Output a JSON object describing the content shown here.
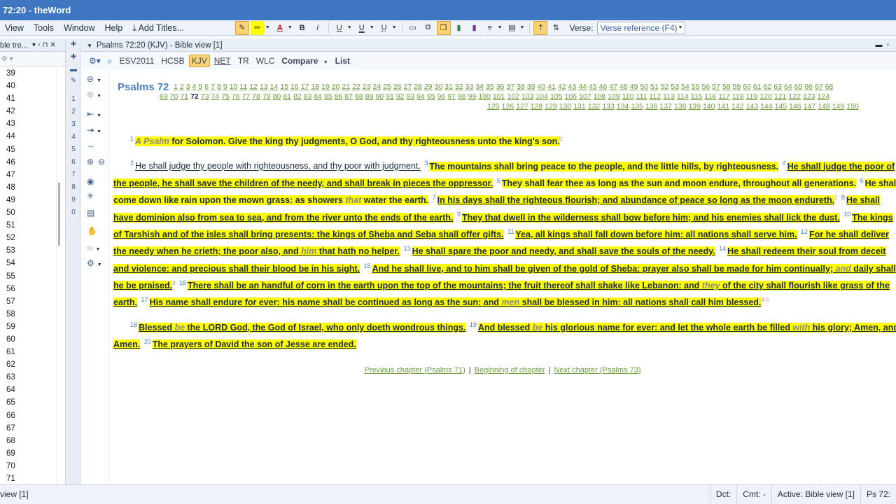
{
  "window": {
    "title": "72:20 - theWord"
  },
  "menu": [
    "View",
    "Tools",
    "Window",
    "Help",
    "Add Titles..."
  ],
  "toolbar": {
    "verse_label": "Verse:",
    "verse_select": "Verse reference (F4)"
  },
  "left_panel": {
    "tab_title": "ble tre...",
    "numbers": [
      "39",
      "40",
      "41",
      "42",
      "43",
      "44",
      "45",
      "46",
      "47",
      "48",
      "49",
      "50",
      "51",
      "52",
      "53",
      "54",
      "55",
      "56",
      "57",
      "58",
      "59",
      "60",
      "61",
      "62",
      "63",
      "64",
      "65",
      "66",
      "67",
      "68",
      "69",
      "70",
      "71"
    ]
  },
  "doc_tab": {
    "title": "Psalms 72:20 (KJV) - Bible view [1]"
  },
  "bible_toolbar": {
    "versions": [
      "ESV2011",
      "HCSB",
      "KJV",
      "NET",
      "TR",
      "WLC"
    ],
    "active_version": "KJV",
    "compare": "Compare",
    "list": "List"
  },
  "bookmarks": [
    "1",
    "2",
    "3",
    "4",
    "5",
    "6",
    "7",
    "8",
    "9",
    "0"
  ],
  "chapter": {
    "title": "Psalms 72",
    "rows": [
      [
        "1",
        "2",
        "3",
        "4",
        "5",
        "6",
        "7",
        "8",
        "9",
        "10",
        "11",
        "12",
        "13",
        "14",
        "15",
        "16",
        "17",
        "18",
        "19",
        "20",
        "21",
        "22",
        "23",
        "24",
        "25",
        "26",
        "27",
        "28",
        "29",
        "30",
        "31",
        "32",
        "33",
        "34",
        "35",
        "36",
        "37",
        "38",
        "39",
        "40",
        "41",
        "42",
        "43",
        "44",
        "45",
        "46",
        "47",
        "48",
        "49",
        "50",
        "51",
        "52",
        "53",
        "54",
        "55",
        "56",
        "57",
        "58",
        "59",
        "60",
        "61",
        "62",
        "63",
        "64",
        "65",
        "66",
        "67",
        "68"
      ],
      [
        "69",
        "70",
        "71",
        "72",
        "73",
        "74",
        "75",
        "76",
        "77",
        "78",
        "79",
        "80",
        "81",
        "82",
        "83",
        "84",
        "85",
        "86",
        "87",
        "88",
        "89",
        "90",
        "91",
        "92",
        "93",
        "94",
        "95",
        "96",
        "97",
        "98",
        "99",
        "100",
        "101",
        "102",
        "103",
        "104",
        "105",
        "106",
        "107",
        "108",
        "109",
        "110",
        "111",
        "112",
        "113",
        "114",
        "115",
        "116",
        "117",
        "118",
        "119",
        "120",
        "121",
        "122",
        "123",
        "124"
      ],
      [
        "125",
        "126",
        "127",
        "128",
        "129",
        "130",
        "131",
        "132",
        "133",
        "134",
        "135",
        "136",
        "137",
        "138",
        "139",
        "140",
        "141",
        "142",
        "143",
        "144",
        "145",
        "146",
        "147",
        "148",
        "149",
        "150"
      ]
    ],
    "current": "72"
  },
  "verses": {
    "v1_num": "1",
    "v1_it": "A Psalm",
    "v1_text": " for Solomon. Give the king thy judgments, O God, and thy righteousness unto the king's son.",
    "v1_fn": "1",
    "v2_num": "2",
    "v2_text": "He shall judge thy people with righteousness, and thy poor with judgment.",
    "v3_num": "3",
    "v3_text": "The mountains shall bring peace to the people, and the little hills, by righteousness.",
    "v4_num": "4",
    "v4_text": "He shall judge the poor of the people, he shall save the children of the needy, and shall break in pieces the oppressor.",
    "v5_num": "5",
    "v5_text": "They shall fear thee as long as the sun and moon endure, throughout all generations.",
    "v6_num": "6",
    "v6_a": "He shall come down like rain upon the mown grass: as showers ",
    "v6_it": "that",
    "v6_b": " water the earth.",
    "v7_num": "7",
    "v7_text": "In his days shall the righteous flourish; and abundance of peace so long as the moon endureth.",
    "v7_fn": "2",
    "v8_num": "8",
    "v8_text": "He shall have dominion also from sea to sea, and from the river unto the ends of the earth.",
    "v9_num": "9",
    "v9_text": "They that dwell in the wilderness shall bow before him; and his enemies shall lick the dust.",
    "v10_num": "10",
    "v10_text": "The kings of Tarshish and of the isles shall bring presents: the kings of Sheba and Seba shall offer gifts.",
    "v11_num": "11",
    "v11_text": "Yea, all kings shall fall down before him: all nations shall serve him.",
    "v12_num": "12",
    "v12_a": "For he shall deliver the needy when he crieth; the poor also, and ",
    "v12_it": "him",
    "v12_b": " that hath no helper.",
    "v13_num": "13",
    "v13_text": "He shall spare the poor and needy, and shall save the souls of the needy.",
    "v14_num": "14",
    "v14_text": "He shall redeem their soul from deceit and violence: and precious shall their blood be in his sight.",
    "v15_num": "15",
    "v15_a": "And he shall live, and to him shall be given of the gold of Sheba: prayer also shall be made for him continually; ",
    "v15_it": "and",
    "v15_b": " daily shall he be praised.",
    "v15_fn": "3",
    "v16_num": "16",
    "v16_a": "There shall be an handful of corn in the earth upon the top of the mountains; the fruit thereof shall shake like Lebanon: and ",
    "v16_it": "they",
    "v16_b": " of the city shall flourish like grass of the earth.",
    "v17_num": "17",
    "v17_a": "His name shall endure for ever: his name shall be continued as long as the sun: and ",
    "v17_it": "men",
    "v17_b": " shall be blessed in him: all nations shall call him blessed.",
    "v17_fn": "4 5",
    "v18_num": "18",
    "v18_a": "Blessed ",
    "v18_it": "be",
    "v18_b": " the LORD God, the God of Israel, who only doeth wondrous things.",
    "v19_num": "19",
    "v19_a": "And blessed ",
    "v19_it1": "be",
    "v19_b": " his glorious name for ever: and let the whole earth be filled ",
    "v19_it2": "with",
    "v19_c": " his glory; Amen, and Amen.",
    "v20_num": "20",
    "v20_text": "The prayers of David the son of Jesse are ended."
  },
  "nav": {
    "prev": "Previous chapter (Psalms 71)",
    "begin": "Beginning of chapter",
    "next": "Next chapter (Psalms 73)",
    "sep": "|"
  },
  "status": {
    "left": "view [1]",
    "dct": "Dct:",
    "cmt": "Cmt: -",
    "active": "Active: Bible view [1]",
    "ref": "Ps 72:"
  }
}
